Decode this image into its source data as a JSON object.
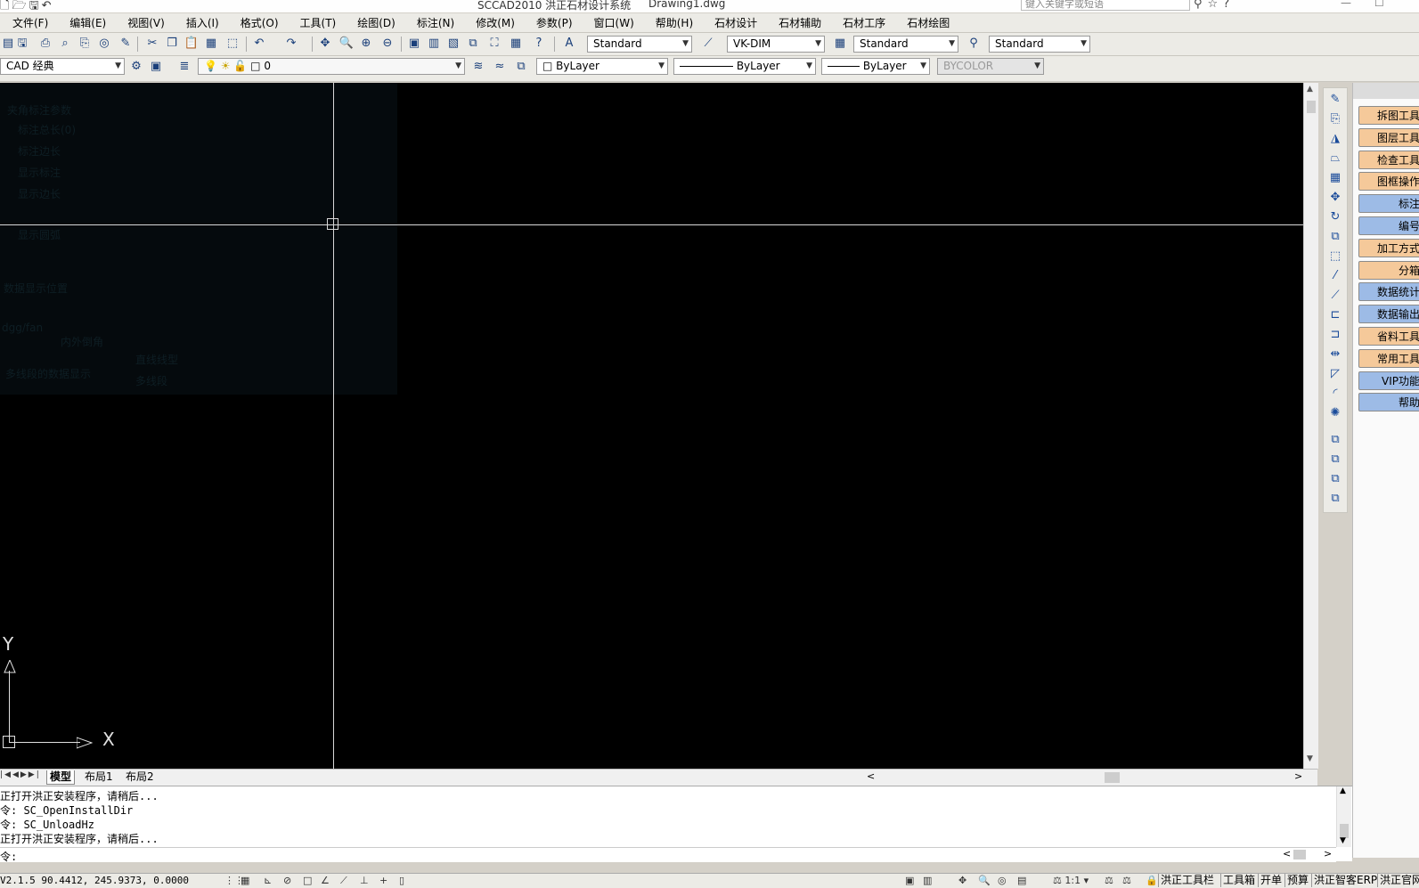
{
  "window": {
    "app_title": "SCCAD2010 洪正石材设计系统",
    "document": "Drawing1.dwg",
    "search_placeholder": "键入关键字或短语"
  },
  "menu": [
    "文件(F)",
    "编辑(E)",
    "视图(V)",
    "插入(I)",
    "格式(O)",
    "工具(T)",
    "绘图(D)",
    "标注(N)",
    "修改(M)",
    "参数(P)",
    "窗口(W)",
    "帮助(H)",
    "石材设计",
    "石材辅助",
    "石材工序",
    "石材绘图"
  ],
  "toolbar_styles": {
    "text_style": "Standard",
    "dim_style": "VK-DIM",
    "table_style": "Standard",
    "multileader_style": "Standard"
  },
  "toolbar_layers": {
    "workspace": "CAD 经典",
    "layer": "0",
    "color": "ByLayer",
    "linetype": "ByLayer",
    "lineweight": "ByLayer",
    "plotstyle": "BYCOLOR"
  },
  "ghost_text": [
    "夹角标注参数",
    "标注总长(0)",
    "标注边长",
    "显示标注",
    "显示边长",
    "显示圆弧",
    "数据显示位置",
    "dgg/fan",
    "内外倒角",
    "直线线型",
    "多线段的数据显示",
    "多线段"
  ],
  "ucs": {
    "y_label": "Y",
    "x_label": "X"
  },
  "right_panel": [
    {
      "label": "拆图工具",
      "color": "orange"
    },
    {
      "label": "图层工具",
      "color": "orange"
    },
    {
      "label": "检查工具",
      "color": "orange"
    },
    {
      "label": "图框操作",
      "color": "orange"
    },
    {
      "label": "标注",
      "color": "blue"
    },
    {
      "label": "编号",
      "color": "blue"
    },
    {
      "label": "加工方式",
      "color": "orange"
    },
    {
      "label": "分箱",
      "color": "orange"
    },
    {
      "label": "数据统计",
      "color": "blue"
    },
    {
      "label": "数据输出",
      "color": "blue"
    },
    {
      "label": "省料工具",
      "color": "orange"
    },
    {
      "label": "常用工具",
      "color": "orange"
    },
    {
      "label": "VIP功能",
      "color": "blue"
    },
    {
      "label": "帮助",
      "color": "blue"
    }
  ],
  "layout_tabs": [
    "模型",
    "布局1",
    "布局2"
  ],
  "command_history": [
    "正打开洪正安装程序，请稍后...",
    "令: SC_OpenInstallDir",
    "令: SC_UnloadHz",
    "正打开洪正安装程序，请稍后..."
  ],
  "command_prompt": "令:",
  "status": {
    "version": "V2.1.5",
    "coordinates": "90.4412, 245.9373, 0.0000",
    "annotation_scale": "1:1",
    "right_buttons": [
      "洪正工具栏",
      "工具箱",
      "开单",
      "预算",
      "洪正智客ERP",
      "洪正官网"
    ]
  },
  "colors": {
    "canvas": "#000000",
    "crosshair": "#d8d8d8",
    "panel_orange": "#f5c99a",
    "panel_blue": "#9dbbe6"
  }
}
